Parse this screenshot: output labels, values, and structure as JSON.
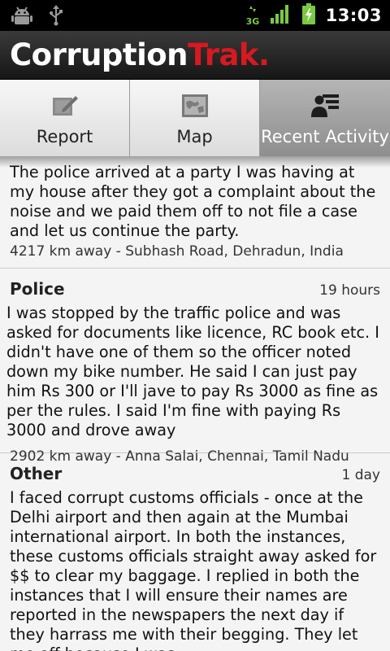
{
  "status_bar": {
    "time": "13:03",
    "network_label": "3G",
    "icons": [
      "android-debug-icon",
      "usb-icon",
      "3g-data-icon",
      "signal-strength-icon",
      "battery-charging-icon"
    ]
  },
  "app": {
    "logo_part1": "Corruption",
    "logo_part2": "Trak",
    "logo_dot": ".",
    "brand_color": "#d71920"
  },
  "tabs": [
    {
      "label": "Report",
      "icon": "report-edit-icon",
      "active": false
    },
    {
      "label": "Map",
      "icon": "map-icon",
      "active": false
    },
    {
      "label": "Recent Activity",
      "icon": "recent-activity-icon",
      "active": true
    }
  ],
  "feed": {
    "items": [
      {
        "category": "",
        "time": "",
        "text": "The police arrived at a party I was having at my house after they got a complaint about the noise and we paid them off to not file a case and let us continue the party.",
        "location": "4217 km away - Subhash Road, Dehradun, India"
      },
      {
        "category": "Police",
        "time": "19 hours",
        "text": "I was stopped by the traffic police and was asked for documents like licence, RC book etc. I didn't have one of them so the officer noted down my bike number. He said I can just pay him Rs 300 or I'll jave to pay Rs 3000 as fine as per the rules. I said I'm fine with paying Rs 3000 and drove away",
        "location": "2902 km away - Anna Salai, Chennai, Tamil Nadu"
      },
      {
        "category": "Other",
        "time": "1 day",
        "text": "I faced corrupt customs officials - once at the Delhi airport and then again at the Mumbai international airport. In both the instances, these customs officials straight away asked for $$ to clear my baggage. I replied in both the instances that I will ensure their names are reported in the newspapers the next day if they harrass me with their begging. They let me off because I was",
        "location": ""
      }
    ]
  }
}
